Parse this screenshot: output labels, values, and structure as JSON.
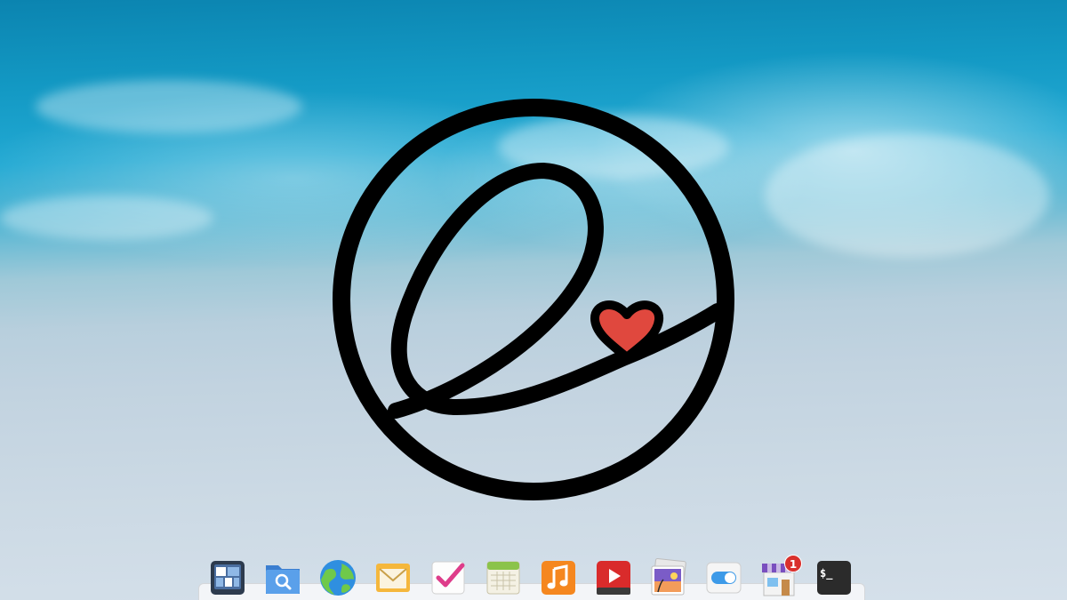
{
  "desktop": {
    "wallpaper": "ocean-beach-aerial",
    "logo": {
      "icon": "elementary-os-logo",
      "stroke_color": "#000000",
      "heart_color": "#e0483e"
    }
  },
  "dock": {
    "items": [
      {
        "name": "multitasking-view",
        "icon": "multitasking-icon"
      },
      {
        "name": "files",
        "icon": "folder-search-icon"
      },
      {
        "name": "web-browser",
        "icon": "globe-icon"
      },
      {
        "name": "mail",
        "icon": "envelope-icon"
      },
      {
        "name": "tasks",
        "icon": "checkmark-icon"
      },
      {
        "name": "calendar",
        "icon": "calendar-icon"
      },
      {
        "name": "music",
        "icon": "music-note-icon"
      },
      {
        "name": "videos",
        "icon": "play-icon"
      },
      {
        "name": "photos",
        "icon": "photos-icon"
      },
      {
        "name": "system-settings",
        "icon": "toggle-switch-icon"
      },
      {
        "name": "appcenter",
        "icon": "shop-icon",
        "badge": "1"
      },
      {
        "name": "terminal",
        "icon": "terminal-icon",
        "text": "$_"
      }
    ],
    "badge_color": "#d9302c"
  }
}
